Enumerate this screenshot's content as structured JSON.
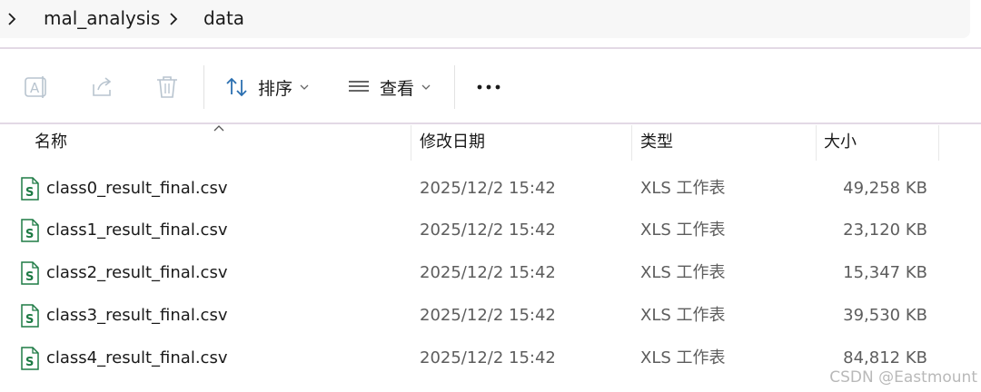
{
  "breadcrumb": {
    "items": [
      "mal_analysis",
      "data"
    ]
  },
  "toolbar": {
    "sort_label": "排序",
    "view_label": "查看",
    "icons": [
      "rename-icon",
      "share-icon",
      "delete-icon",
      "sort-icon",
      "view-icon",
      "more-icon"
    ]
  },
  "columns": {
    "name": "名称",
    "date": "修改日期",
    "type": "类型",
    "size": "大小"
  },
  "files": [
    {
      "name": "class0_result_final.csv",
      "date": "2025/12/2 15:42",
      "type": "XLS 工作表",
      "size": "49,258 KB"
    },
    {
      "name": "class1_result_final.csv",
      "date": "2025/12/2 15:42",
      "type": "XLS 工作表",
      "size": "23,120 KB"
    },
    {
      "name": "class2_result_final.csv",
      "date": "2025/12/2 15:42",
      "type": "XLS 工作表",
      "size": "15,347 KB"
    },
    {
      "name": "class3_result_final.csv",
      "date": "2025/12/2 15:42",
      "type": "XLS 工作表",
      "size": "39,530 KB"
    },
    {
      "name": "class4_result_final.csv",
      "date": "2025/12/2 15:42",
      "type": "XLS 工作表",
      "size": "84,812 KB"
    }
  ],
  "watermark": "CSDN @Eastmount",
  "colors": {
    "file_icon_green": "#1e7b45",
    "toolbar_icon_blue": "#2a6fb0",
    "disabled_icon": "#b8c4cf",
    "separator": "#e3d9e5"
  }
}
